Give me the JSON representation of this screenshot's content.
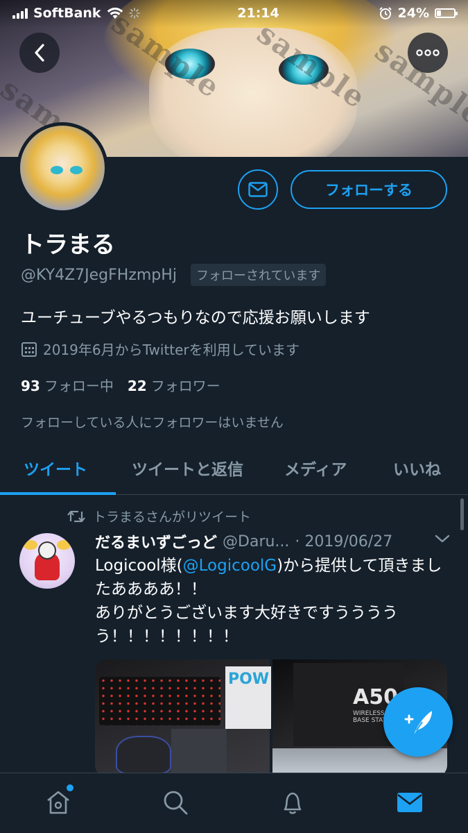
{
  "status_bar": {
    "carrier": "SoftBank",
    "time": "21:14",
    "battery": "24%",
    "battery_level": 0.24
  },
  "header": {
    "watermark": "sample",
    "back_icon": "chevron-left-icon",
    "more_icon": "ellipsis-icon"
  },
  "profile": {
    "display_name": "トラまる",
    "handle": "@KY4Z7JegFHzmpHj",
    "follows_you": "フォローされています",
    "bio": "ユーチューブやるつもりなので応援お願いします",
    "joined": "2019年6月からTwitterを利用しています",
    "following_count": "93",
    "following_label": "フォロー中",
    "followers_count": "22",
    "followers_label": "フォロワー",
    "no_mutual_followers": "フォローしている人にフォロワーはいません",
    "follow_button": "フォローする"
  },
  "tabs": [
    {
      "label": "ツイート",
      "active": true
    },
    {
      "label": "ツイートと返信",
      "active": false
    },
    {
      "label": "メディア",
      "active": false
    },
    {
      "label": "いいね",
      "active": false
    }
  ],
  "tweet": {
    "retweet_label": "トラまるさんがリツイート",
    "author_name": "だるまいずごっど",
    "author_handle": "@Daru...",
    "date": "· 2019/06/27",
    "text_pre": "Logicool様(",
    "mention": "@LogicoolG",
    "text_post": ")から提供して頂きましたああああ！！",
    "text_line2": "ありがとうございます大好きですううううう！！！！！！！！",
    "media_label_1": "POW",
    "media_label_2": "A50",
    "media_label_2_sub": "WIRELESS + BASE STATION"
  },
  "bottom_nav": {
    "items": [
      "home-icon",
      "search-icon",
      "bell-icon",
      "mail-icon"
    ],
    "active": "mail-icon"
  },
  "colors": {
    "background": "#15202b",
    "accent": "#1da1f2",
    "secondary_text": "#8899a6",
    "divider": "#38444d"
  }
}
